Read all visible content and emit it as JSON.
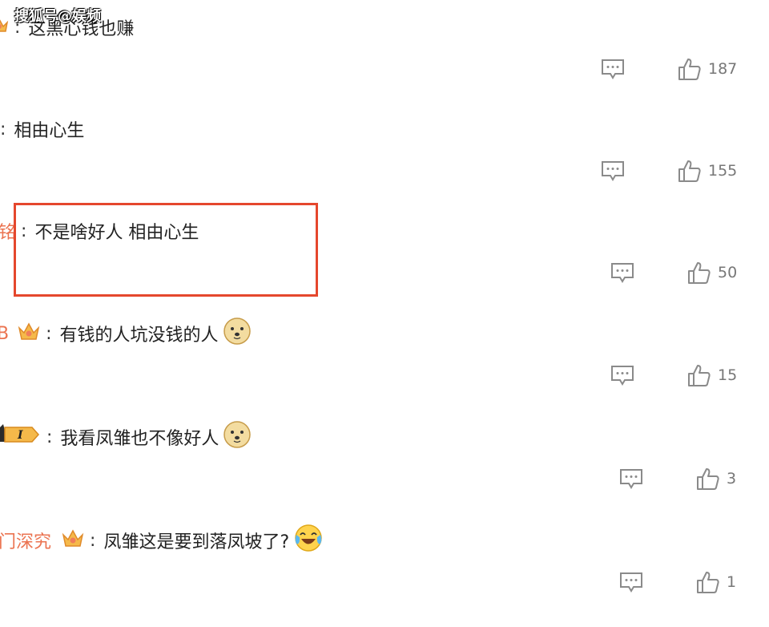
{
  "watermark": "搜狐号@娱频",
  "colors": {
    "username": "#eb7350",
    "highlight_border": "#e5472d",
    "icon": "#8a8a8a"
  },
  "comments": [
    {
      "user": "",
      "has_badge": "crown",
      "text": "这黑心钱也赚",
      "emoji": "",
      "likes": "187"
    },
    {
      "user": "",
      "has_badge": "",
      "text": "相由心生",
      "emoji": "",
      "likes": "155"
    },
    {
      "user": "铭",
      "has_badge": "",
      "text": "不是啥好人 相由心生",
      "emoji": "",
      "likes": "50"
    },
    {
      "user": "B",
      "has_badge": "crown",
      "text": "有钱的人坑没钱的人",
      "emoji": "doge",
      "likes": "15"
    },
    {
      "user": "",
      "has_badge": "level",
      "badge_text": "I",
      "text": "我看凤雏也不像好人",
      "emoji": "doge",
      "likes": "3"
    },
    {
      "user": "门深究",
      "has_badge": "crown",
      "text": "凤雏这是要到落凤坡了?",
      "emoji": "laugh-cry",
      "likes": "1"
    }
  ]
}
